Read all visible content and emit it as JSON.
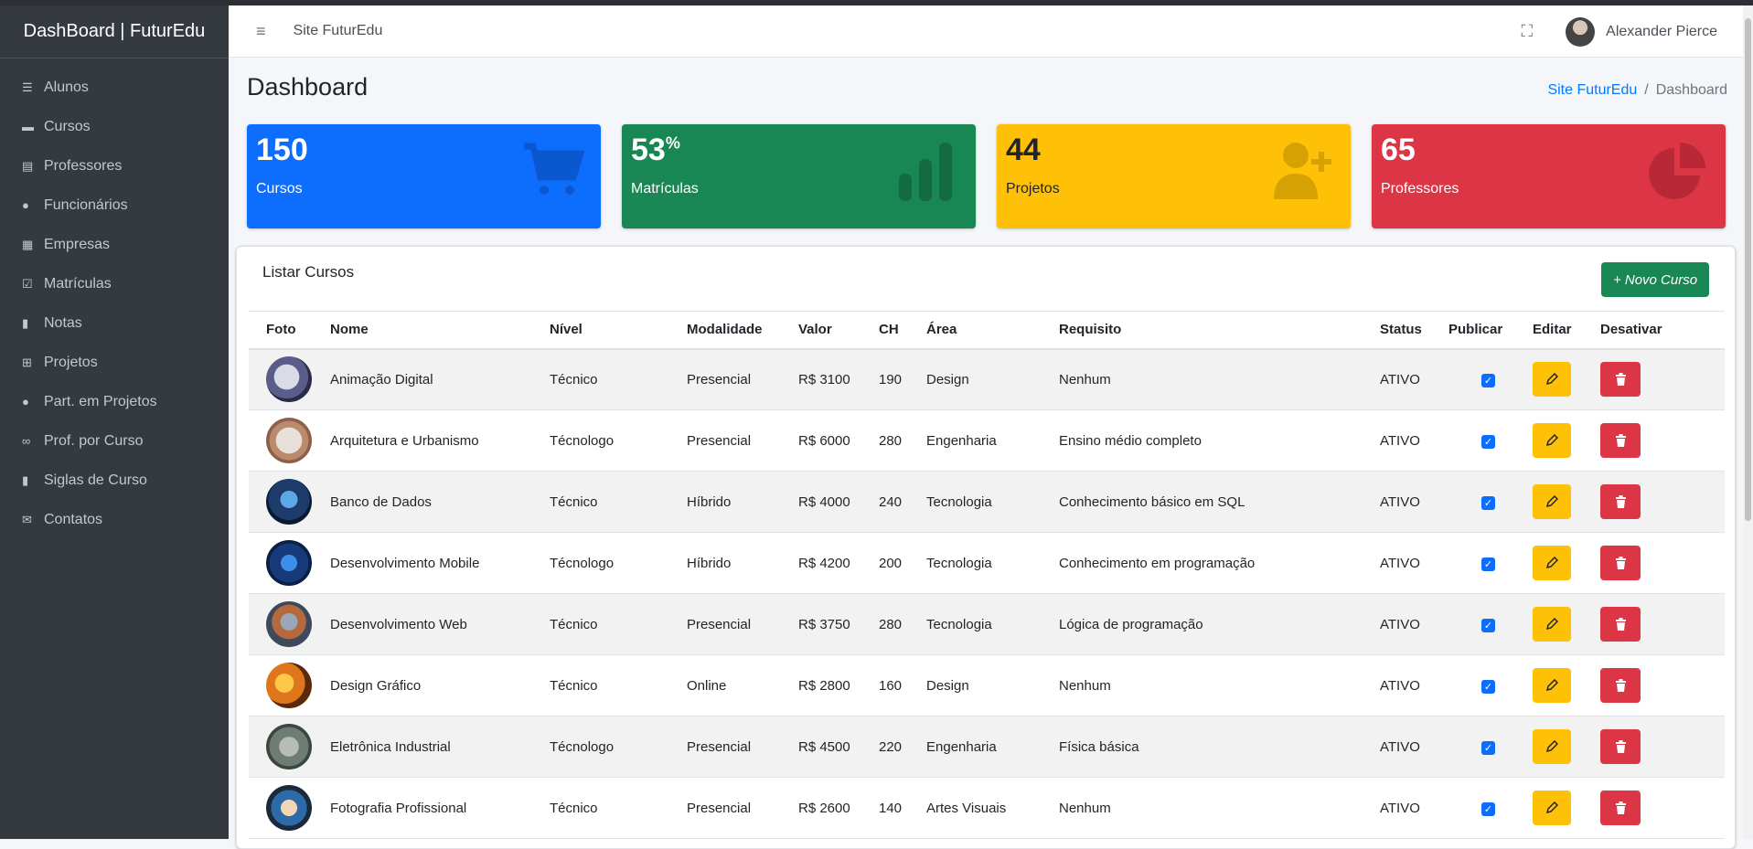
{
  "brand": "DashBoard | FuturEdu",
  "sidebar": {
    "items": [
      {
        "label": "Alunos",
        "icon": "user-list-icon"
      },
      {
        "label": "Cursos",
        "icon": "book-icon"
      },
      {
        "label": "Professores",
        "icon": "id-card-icon"
      },
      {
        "label": "Funcionários",
        "icon": "user-icon"
      },
      {
        "label": "Empresas",
        "icon": "building-icon"
      },
      {
        "label": "Matrículas",
        "icon": "checklist-icon"
      },
      {
        "label": "Notas",
        "icon": "bar-chart-icon"
      },
      {
        "label": "Projetos",
        "icon": "sitemap-icon"
      },
      {
        "label": "Part. em Projetos",
        "icon": "person-icon"
      },
      {
        "label": "Prof. por Curso",
        "icon": "link-icon"
      },
      {
        "label": "Siglas de Curso",
        "icon": "bookmark-icon"
      },
      {
        "label": "Contatos",
        "icon": "envelope-icon"
      }
    ]
  },
  "topbar": {
    "site_link": "Site FuturEdu",
    "user_name": "Alexander Pierce"
  },
  "page": {
    "title": "Dashboard",
    "breadcrumb": {
      "link": "Site FuturEdu",
      "separator": "/",
      "current": "Dashboard"
    }
  },
  "stats": [
    {
      "value": "150",
      "suffix": "",
      "label": "Cursos",
      "color": "#0d6efd",
      "icon": "cart-icon"
    },
    {
      "value": "53",
      "suffix": "%",
      "label": "Matrículas",
      "color": "#198754",
      "icon": "bar-chart-icon"
    },
    {
      "value": "44",
      "suffix": "",
      "label": "Projetos",
      "color": "#ffc107",
      "icon": "user-plus-icon"
    },
    {
      "value": "65",
      "suffix": "",
      "label": "Professores",
      "color": "#dc3545",
      "icon": "pie-chart-icon"
    }
  ],
  "card": {
    "title": "Listar Cursos",
    "new_button": "+ Novo Curso"
  },
  "table": {
    "headers": [
      "Foto",
      "Nome",
      "Nível",
      "Modalidade",
      "Valor",
      "CH",
      "Área",
      "Requisito",
      "Status",
      "Publicar",
      "Editar",
      "Desativar"
    ],
    "rows": [
      {
        "nome": "Animação Digital",
        "nivel": "Técnico",
        "modalidade": "Presencial",
        "valor": "R$ 3100",
        "ch": "190",
        "area": "Design",
        "requisito": "Nenhum",
        "status": "ATIVO"
      },
      {
        "nome": "Arquitetura e Urbanismo",
        "nivel": "Técnologo",
        "modalidade": "Presencial",
        "valor": "R$ 6000",
        "ch": "280",
        "area": "Engenharia",
        "requisito": "Ensino médio completo",
        "status": "ATIVO"
      },
      {
        "nome": "Banco de Dados",
        "nivel": "Técnico",
        "modalidade": "Híbrido",
        "valor": "R$ 4000",
        "ch": "240",
        "area": "Tecnologia",
        "requisito": "Conhecimento básico em SQL",
        "status": "ATIVO"
      },
      {
        "nome": "Desenvolvimento Mobile",
        "nivel": "Técnologo",
        "modalidade": "Híbrido",
        "valor": "R$ 4200",
        "ch": "200",
        "area": "Tecnologia",
        "requisito": "Conhecimento em programação",
        "status": "ATIVO"
      },
      {
        "nome": "Desenvolvimento Web",
        "nivel": "Técnico",
        "modalidade": "Presencial",
        "valor": "R$ 3750",
        "ch": "280",
        "area": "Tecnologia",
        "requisito": "Lógica de programação",
        "status": "ATIVO"
      },
      {
        "nome": "Design Gráfico",
        "nivel": "Técnico",
        "modalidade": "Online",
        "valor": "R$ 2800",
        "ch": "160",
        "area": "Design",
        "requisito": "Nenhum",
        "status": "ATIVO"
      },
      {
        "nome": "Eletrônica Industrial",
        "nivel": "Técnologo",
        "modalidade": "Presencial",
        "valor": "R$ 4500",
        "ch": "220",
        "area": "Engenharia",
        "requisito": "Física básica",
        "status": "ATIVO"
      },
      {
        "nome": "Fotografia Profissional",
        "nivel": "Técnico",
        "modalidade": "Presencial",
        "valor": "R$ 2600",
        "ch": "140",
        "area": "Artes Visuais",
        "requisito": "Nenhum",
        "status": "ATIVO"
      }
    ]
  }
}
